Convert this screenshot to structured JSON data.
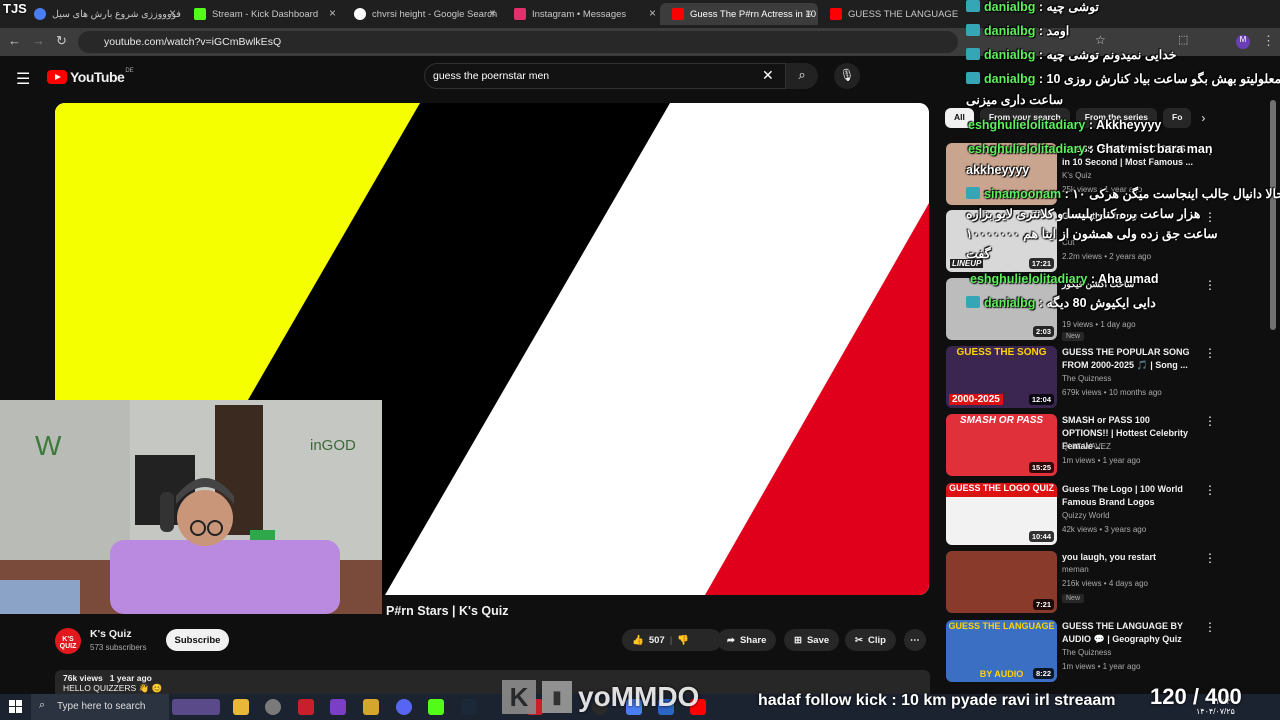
{
  "tabs": [
    {
      "label": "فووووززی شروع بارش های سیل",
      "fav": "#4a7ef0"
    },
    {
      "label": "Stream - Kick Dashboard",
      "fav": "#53fc18"
    },
    {
      "label": "chvrsi height - Google Search",
      "fav": "#ffffff"
    },
    {
      "label": "Instagram • Messages",
      "fav": "#e1306c"
    },
    {
      "label": "Guess The P#rn Actress in 10 S",
      "fav": "#ff0000"
    },
    {
      "label": "GUESS THE LANGUAGE BY AU",
      "fav": "#ff0000"
    }
  ],
  "address": {
    "url": "youtube.com/watch?v=iGCmBwlkEsQ"
  },
  "header": {
    "logo_text": "YouTube",
    "country": "DE",
    "search_value": "guess the poernstar men"
  },
  "video": {
    "title": "Guess The P#rn Actress in 10 Seconds | Most Famous P#rn Stars | K's Quiz",
    "visible_title": "P#rn Stars | K's Quiz",
    "channel": "K's Quiz",
    "channel_avatar_text": "K'S QUIZ",
    "subscribers": "573 subscribers",
    "subscribe_label": "Subscribe",
    "likes": "507",
    "share_label": "Share",
    "save_label": "Save",
    "clip_label": "Clip",
    "views": "76k views",
    "age": "1 year ago",
    "desc_line": "HELLO QUIZZERS 👋 😊"
  },
  "chips": [
    {
      "label": "All"
    },
    {
      "label": "From your search"
    },
    {
      "label": "From the series"
    },
    {
      "label": "Fo"
    }
  ],
  "recommended": [
    {
      "title": "GUESS THE P#RN ACTRESS in 10 Second | Most Famous ...",
      "channel": "K's Quiz",
      "meta": "25k views • 1 year ago",
      "duration": "",
      "new": ""
    },
    {
      "title": "Guess the Lineup",
      "channel": "Cut",
      "meta": "2.2m views • 2 years ago",
      "duration": "17:21",
      "new": ""
    },
    {
      "title": "ساخت اکشن فیگور",
      "channel": "",
      "meta": "19 views • 1 day ago",
      "duration": "2:03",
      "new": "New"
    },
    {
      "title": "GUESS THE POPULAR SONG FROM 2000-2025 🎵 | Song ...",
      "channel": "The Quizness",
      "meta": "679k views • 10 months ago",
      "duration": "12:04",
      "new": ""
    },
    {
      "title": "SMASH or PASS 100 OPTIONS!! | Hottest Celebrity Female ...",
      "channel": "QUIZ WAVEZ",
      "meta": "1m views • 1 year ago",
      "duration": "15:25",
      "new": ""
    },
    {
      "title": "Guess The Logo | 100 World Famous Brand Logos",
      "channel": "Quizzy World",
      "meta": "42k views • 3 years ago",
      "duration": "10:44",
      "new": ""
    },
    {
      "title": "you laugh, you restart",
      "channel": "meman",
      "meta": "216k views • 4 days ago",
      "duration": "7:21",
      "new": "New"
    },
    {
      "title": "GUESS THE LANGUAGE BY AUDIO 💬 | Geography Quiz",
      "channel": "The Quizness",
      "meta": "1m views • 1 year ago",
      "duration": "8:22",
      "new": ""
    }
  ],
  "thumb_text": [
    "GUESS THE SONG",
    "2000-2025",
    "SMASH OR PASS",
    "GUESS THE LOGO QUIZ",
    "GUESS THE LANGUAGE",
    "BY AUDIO",
    "LINEUP"
  ],
  "chat": [
    {
      "user": "danialbg",
      "msg": "توشی چیه"
    },
    {
      "user": "danialbg",
      "msg": "اومد"
    },
    {
      "user": "danialbg",
      "msg": "خدایی نمیدونم توشی چیه"
    },
    {
      "user": "danialbg",
      "msg": "معلولیتو بهش بگو ساعت بیاد کنارش روزی 10"
    },
    {
      "user": "",
      "msg": "ساعت داری میزنی"
    },
    {
      "user": "eshghulielolitadiary",
      "msg": "Akkheyyyy"
    },
    {
      "user": "eshghulielolitadiary",
      "msg": "Chat mist bara man"
    },
    {
      "user": "",
      "msg": "akkheyyyy"
    },
    {
      "user": "sinamoonam",
      "msg": "حالا دانیال جالب اینجاست میگن هرکی ۱۰"
    },
    {
      "user": "",
      "msg": "هزار ساعت بره کنار پلیسا و کلانتری لایو بزاره"
    },
    {
      "user": "",
      "msg": "۱۰۰۰۰۰۰۰ ساعت جق زده ولی همشون از اینا هم"
    },
    {
      "user": "",
      "msg": "گفت"
    },
    {
      "user": "eshghulielolitadiary",
      "msg": "Aha umad"
    },
    {
      "user": "danialbg",
      "msg": "دایی ایکیوش 80 دیگه"
    }
  ],
  "overlay": {
    "stream_tag": "TJS",
    "handle": "yoMMDO",
    "goal_text": "hadaf follow kick : 10 km pyade ravi irl streaam",
    "goal_count": "120 / 400"
  },
  "taskbar": {
    "search_placeholder": "Type here to search",
    "time": "۱۷:۳۰",
    "date": "۱۴۰۴/۰۷/۲۵"
  },
  "colors": {
    "bg": "#0f0f0f",
    "chat_user": "#5ef15e",
    "kick_green": "#53fc18",
    "yt_red": "#ff0000",
    "flag_yellow": "#f5ff00",
    "flag_red": "#e0001b"
  }
}
